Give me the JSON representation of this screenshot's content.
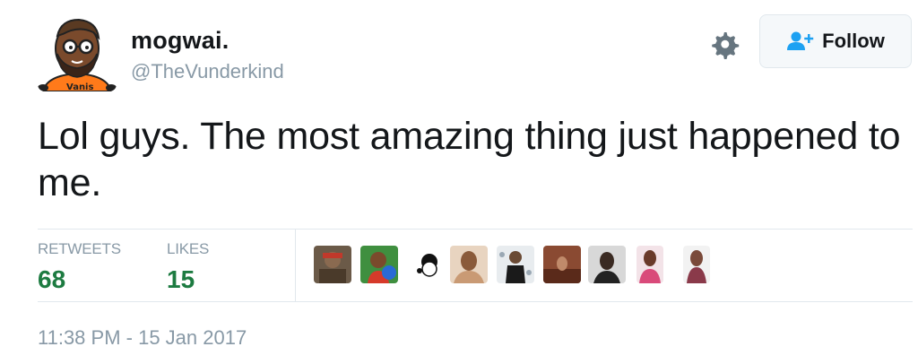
{
  "user": {
    "name": "mogwai.",
    "handle": "@TheVunderkind",
    "avatar_icon": "cartoon-avatar-icon"
  },
  "actions": {
    "gear_icon": "gear-icon",
    "follow_icon": "add-user-icon",
    "follow_label": "Follow"
  },
  "tweet": {
    "text": "Lol guys. The most amazing thing just happened to me."
  },
  "stats": {
    "retweets_label": "RETWEETS",
    "retweets_value": "68",
    "likes_label": "LIKES",
    "likes_value": "15"
  },
  "likers": [
    {
      "name": "liker-avatar-1",
      "color": "#5a4b3c"
    },
    {
      "name": "liker-avatar-2",
      "color": "#3a7a3a"
    },
    {
      "name": "liker-avatar-3",
      "color": "#ffffff"
    },
    {
      "name": "liker-avatar-4",
      "color": "#c99a74"
    },
    {
      "name": "liker-avatar-5",
      "color": "#d8dde2"
    },
    {
      "name": "liker-avatar-6",
      "color": "#8a4a32"
    },
    {
      "name": "liker-avatar-7",
      "color": "#3b3b3b"
    },
    {
      "name": "liker-avatar-8",
      "color": "#d98aa0"
    },
    {
      "name": "liker-avatar-9",
      "color": "#e5e5e5"
    }
  ],
  "timestamp": "11:38 PM - 15 Jan 2017",
  "colors": {
    "stat_value": "#1d7b41",
    "muted_text": "#8899a6",
    "divider": "#e1e8ed",
    "follow_icon": "#1da1f2"
  }
}
